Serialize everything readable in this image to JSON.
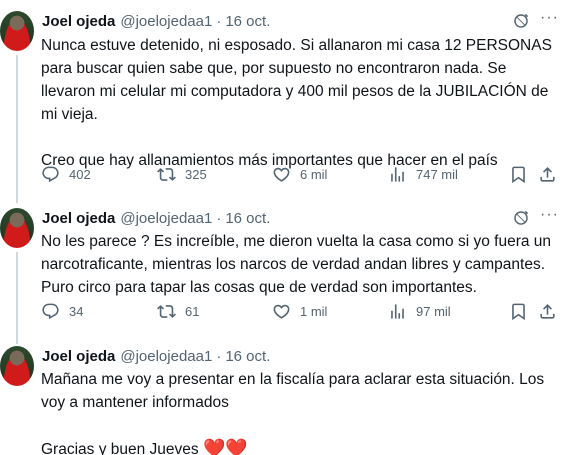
{
  "tweets": [
    {
      "author": {
        "name": "Joel ojeda",
        "handle": "@joelojedaa1",
        "date": "16 oct."
      },
      "paragraphs": [
        "Nunca estuve detenido, ni esposado. Si allanaron mi casa 12 PERSONAS para buscar quien sabe que, por supuesto no encontraron nada. Se llevaron mi celular mi computadora y 400 mil pesos de la JUBILACIÓN de mi vieja.",
        "Creo que hay allanamientos más importantes que hacer en el país"
      ],
      "stats": {
        "replies": "402",
        "retweets": "325",
        "likes": "6 mil",
        "views": "747 mil"
      }
    },
    {
      "author": {
        "name": "Joel ojeda",
        "handle": "@joelojedaa1",
        "date": "16 oct."
      },
      "paragraphs": [
        "No les parece ? Es increíble, me dieron vuelta la casa como si yo fuera un narcotraficante, mientras los narcos de verdad andan libres y campantes. Puro circo para tapar las cosas que de verdad son importantes."
      ],
      "stats": {
        "replies": "34",
        "retweets": "61",
        "likes": "1 mil",
        "views": "97 mil"
      }
    },
    {
      "author": {
        "name": "Joel ojeda",
        "handle": "@joelojedaa1",
        "date": "16 oct."
      },
      "paragraphs": [
        "Mañana me voy a presentar en la fiscalía para aclarar esta situación. Los voy a mantener informados",
        "Gracias y buen Jueves"
      ],
      "emoji": "❤️❤️"
    }
  ],
  "icons": {
    "reply": "reply-icon",
    "retweet": "retweet-icon",
    "like": "heart-icon",
    "views": "views-icon",
    "bookmark": "bookmark-icon",
    "share": "share-icon",
    "grok": "grok-icon",
    "more": "more-icon"
  },
  "colors": {
    "text": "#0f1419",
    "secondary": "#536471",
    "heart": "#e0245e",
    "thread_line": "#cfd9de"
  }
}
